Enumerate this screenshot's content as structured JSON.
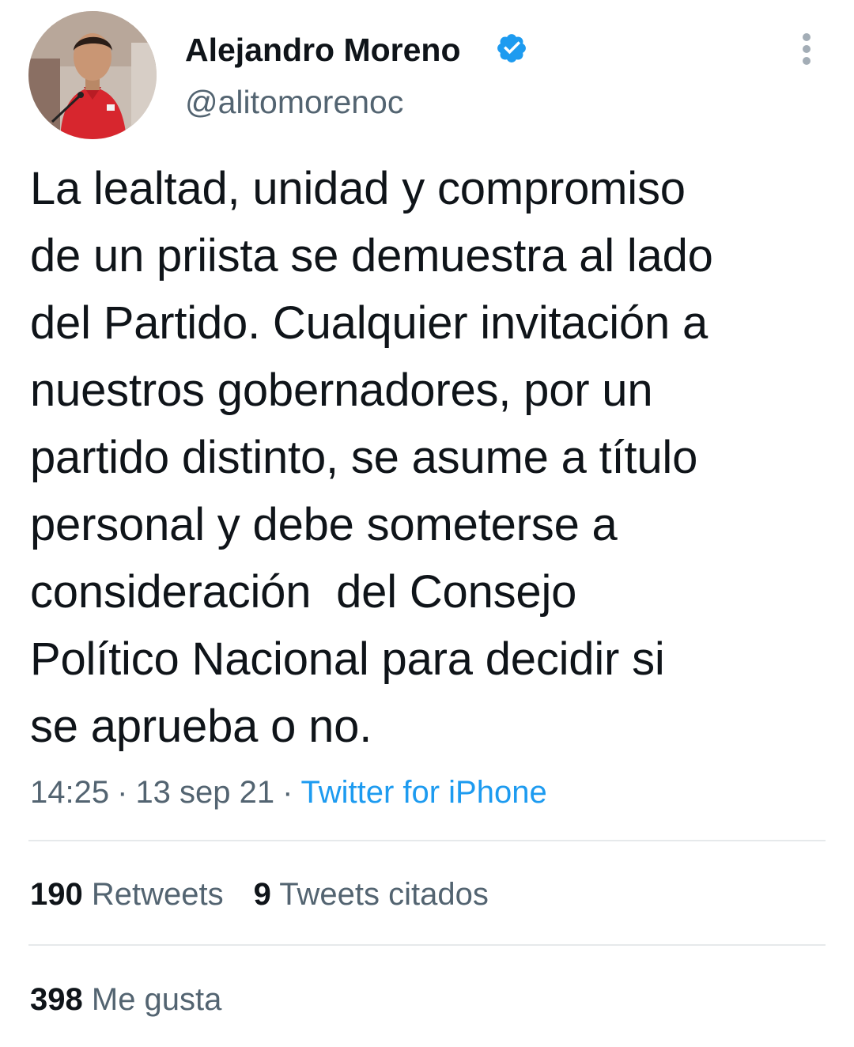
{
  "author": {
    "display_name": "Alejandro Moreno",
    "handle": "@alitomorenoc",
    "verified": true,
    "avatar_icon": "profile-photo",
    "verified_icon": "verified-badge-icon",
    "more_icon": "vertical-dots-icon"
  },
  "tweet": {
    "text": "La lealtad, unidad y compromiso\nde un priista se demuestra al lado\ndel Partido. Cualquier invitación a\nnuestros gobernadores, por un\npartido distinto, se asume a título\npersonal y debe someterse a\nconsideración  del Consejo\nPolítico Nacional para decidir si\nse aprueba o no.",
    "time": "14:25",
    "date": "13 sep 21",
    "separator": "·",
    "source": "Twitter for iPhone"
  },
  "stats": {
    "retweets_count": "190",
    "retweets_label": "Retweets",
    "quotes_count": "9",
    "quotes_label": "Tweets citados",
    "likes_count": "398",
    "likes_label": "Me gusta"
  },
  "colors": {
    "text": "#0f1419",
    "secondary": "#536471",
    "accent": "#1d9bf0",
    "divider": "#e6e9eb"
  }
}
